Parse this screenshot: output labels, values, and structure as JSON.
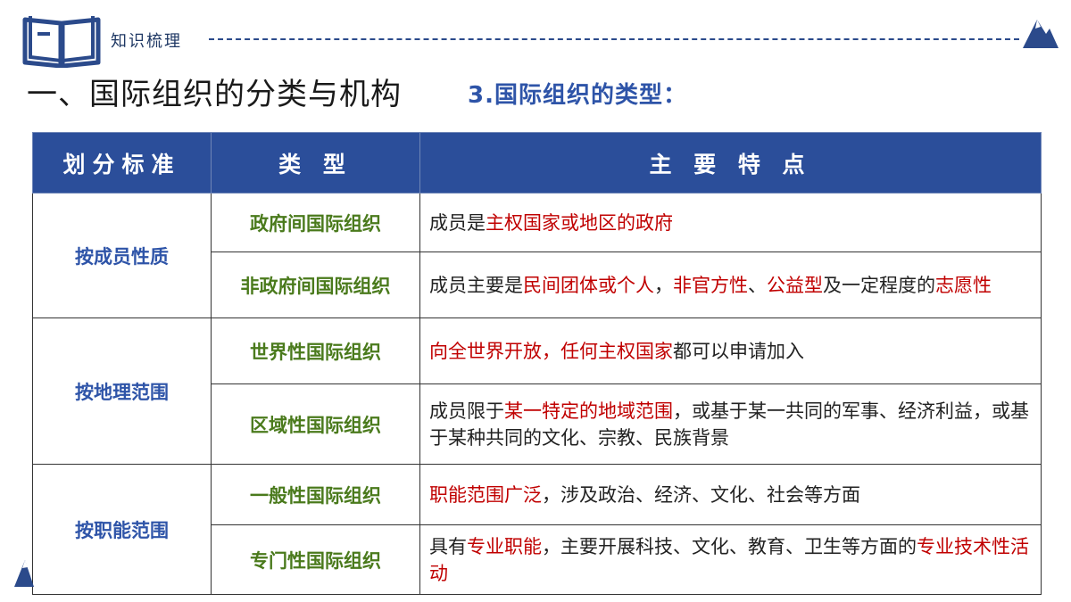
{
  "header": {
    "label": "知识梳理",
    "book_icon": "open-book-icon",
    "mountain_icon": "mountain-icon"
  },
  "title": {
    "main": "一、国际组织的分类与机构",
    "sub": "3.国际组织的类型："
  },
  "colors": {
    "header_bg": "#2b4e9a",
    "criterion_text": "#2e54a8",
    "type_text": "#4a7a1c",
    "highlight": "#c00000"
  },
  "table": {
    "headers": [
      "划分标准",
      "类 型",
      "主 要 特 点"
    ],
    "groups": [
      {
        "criterion": "按成员性质",
        "rows": [
          {
            "type": "政府间国际组织",
            "feature": [
              {
                "t": "成员是",
                "h": false
              },
              {
                "t": "主权国家或地区的政府",
                "h": true
              }
            ]
          },
          {
            "type": "非政府间国际组织",
            "feature": [
              {
                "t": "成员主要是",
                "h": false
              },
              {
                "t": "民间团体或个人",
                "h": true
              },
              {
                "t": "，",
                "h": false
              },
              {
                "t": "非官方性",
                "h": true
              },
              {
                "t": "、",
                "h": false
              },
              {
                "t": "公益型",
                "h": true
              },
              {
                "t": "及一定程度的",
                "h": false
              },
              {
                "t": "志愿性",
                "h": true
              }
            ]
          }
        ]
      },
      {
        "criterion": "按地理范围",
        "rows": [
          {
            "type": "世界性国际组织",
            "feature": [
              {
                "t": "向全世界开放，任何主权国家",
                "h": true
              },
              {
                "t": "都可以申请加入",
                "h": false
              }
            ]
          },
          {
            "type": "区域性国际组织",
            "feature": [
              {
                "t": "成员限于",
                "h": false
              },
              {
                "t": "某一特定的地域范围",
                "h": true
              },
              {
                "t": "，或基于某一共同的军事、经济利益，或基于某种共同的文化、宗教、民族背景",
                "h": false
              }
            ]
          }
        ]
      },
      {
        "criterion": "按职能范围",
        "rows": [
          {
            "type": "一般性国际组织",
            "feature": [
              {
                "t": "职能范围广泛",
                "h": true
              },
              {
                "t": "，涉及政治、经济、文化、社会等方面",
                "h": false
              }
            ]
          },
          {
            "type": "专门性国际组织",
            "feature": [
              {
                "t": "具有",
                "h": false
              },
              {
                "t": "专业职能",
                "h": true
              },
              {
                "t": "，主要开展科技、文化、教育、卫生等方面的",
                "h": false
              },
              {
                "t": "专业技术性活动",
                "h": true
              }
            ]
          }
        ]
      }
    ]
  }
}
